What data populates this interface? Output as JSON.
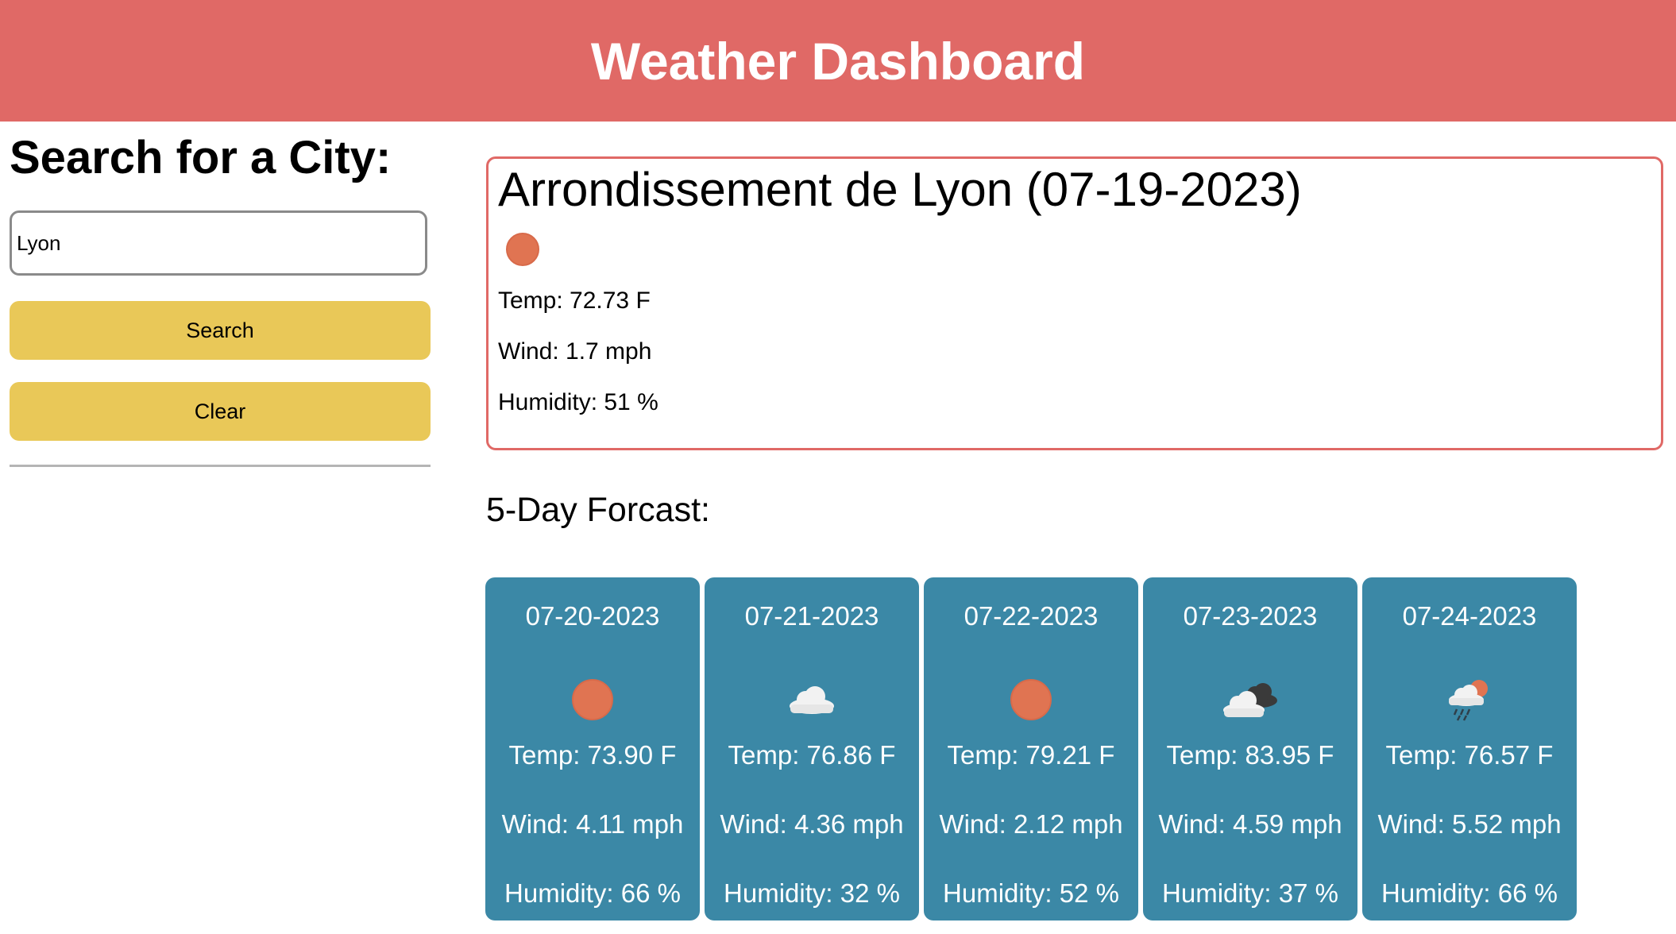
{
  "header": {
    "title": "Weather Dashboard"
  },
  "sidebar": {
    "heading": "Search for a City:",
    "search_value": "Lyon",
    "search_label": "Search",
    "clear_label": "Clear"
  },
  "current": {
    "title": "Arrondissement de Lyon (07-19-2023)",
    "icon": "sun-icon",
    "temp": "Temp: 72.73 F",
    "wind": "Wind: 1.7 mph",
    "humidity": "Humidity: 51 %"
  },
  "forecast": {
    "title": "5-Day Forcast:",
    "days": [
      {
        "date": "07-20-2023",
        "icon": "sun-icon",
        "temp": "Temp: 73.90 F",
        "wind": "Wind: 4.11 mph",
        "humidity": "Humidity: 66 %"
      },
      {
        "date": "07-21-2023",
        "icon": "cloud-icon",
        "temp": "Temp: 76.86 F",
        "wind": "Wind: 4.36 mph",
        "humidity": "Humidity: 32 %"
      },
      {
        "date": "07-22-2023",
        "icon": "sun-icon",
        "temp": "Temp: 79.21 F",
        "wind": "Wind: 2.12 mph",
        "humidity": "Humidity: 52 %"
      },
      {
        "date": "07-23-2023",
        "icon": "broken-clouds-icon",
        "temp": "Temp: 83.95 F",
        "wind": "Wind: 4.59 mph",
        "humidity": "Humidity: 37 %"
      },
      {
        "date": "07-24-2023",
        "icon": "rain-sun-icon",
        "temp": "Temp: 76.57 F",
        "wind": "Wind: 5.52 mph",
        "humidity": "Humidity: 66 %"
      }
    ]
  },
  "colors": {
    "header": "#e06966",
    "button": "#e9c858",
    "card": "#3b88a6",
    "sun": "#e07452"
  }
}
